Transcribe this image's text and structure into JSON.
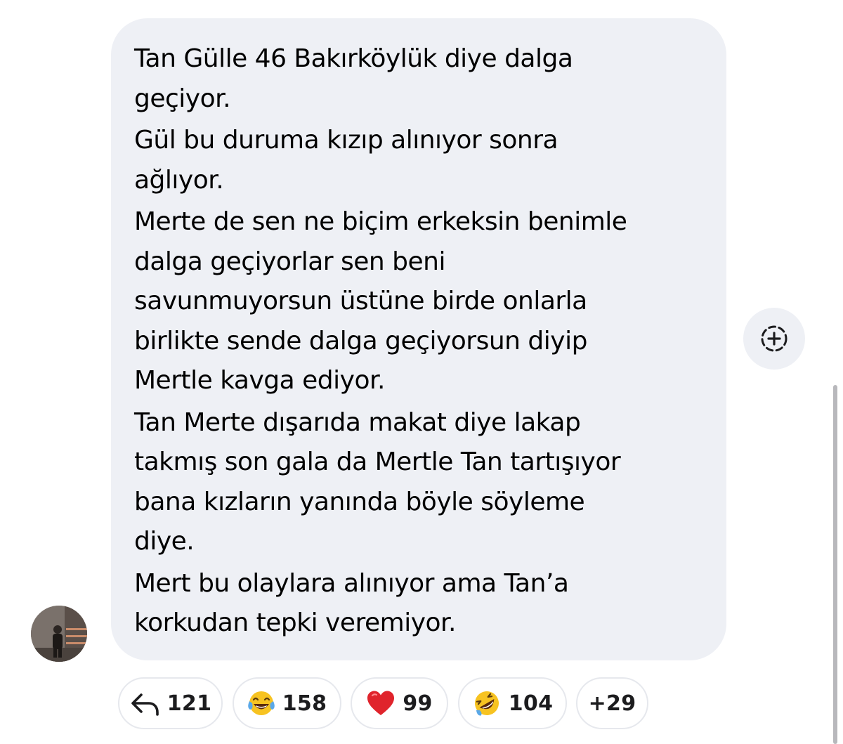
{
  "message": {
    "paragraphs": [
      "Tan Gülle 46 Bakırköylük diye dalga\ngeçiyor.",
      "Gül bu duruma kızıp alınıyor sonra\nağlıyor.",
      "Merte de sen ne biçim erkeksin benimle\ndalga geçiyorlar sen beni\nsavunmuyorsun üstüne birde onlarla\nbirlikte sende dalga geçiyorsun diyip\nMertle kavga ediyor.",
      "Tan Merte dışarıda makat diye lakap\ntakmış son gala da Mertle Tan tartışıyor\nbana kızların yanında böyle söyleme\ndiye.",
      "Mert bu olaylara alınıyor ama Tan’a\nkorkudan tepki veremiyor."
    ]
  },
  "reactions": [
    {
      "icon": "reply-arrow-icon",
      "count": "121"
    },
    {
      "icon": "tears-of-joy-emoji",
      "count": "158"
    },
    {
      "icon": "red-heart-emoji",
      "count": "99"
    },
    {
      "icon": "rolling-laughing-emoji",
      "count": "104"
    },
    {
      "icon": "",
      "count": "+29"
    }
  ],
  "icons": {
    "add_reaction": "add-reaction-icon",
    "avatar": "user-avatar"
  },
  "colors": {
    "bubble_bg": "#eef0f5",
    "text": "#000000",
    "pill_border": "#e6e8ed",
    "heart": "#e0242c",
    "emoji_yellow": "#f7c321"
  }
}
